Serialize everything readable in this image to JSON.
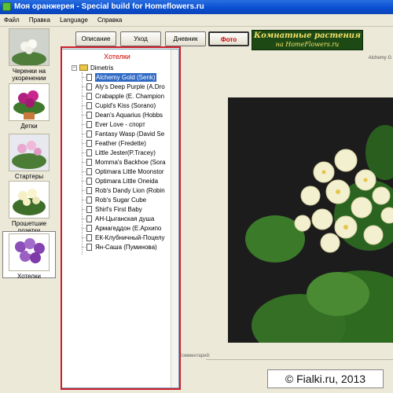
{
  "window": {
    "title": "Моя оранжерея - Special build for Homeflowers.ru"
  },
  "menu": [
    "Файл",
    "Правка",
    "Language",
    "Справка"
  ],
  "sidebar": {
    "items": [
      {
        "label": "Черенки на укоренении",
        "active": false
      },
      {
        "label": "Детки",
        "active": false
      },
      {
        "label": "Стартеры",
        "active": false
      },
      {
        "label": "Прошетшие розетки",
        "active": false
      },
      {
        "label": "Хотелки",
        "active": true
      }
    ]
  },
  "toolbar": {
    "buttons": [
      "Описание",
      "Уход",
      "Дневник",
      "Фото"
    ],
    "active": "Фото"
  },
  "logo": {
    "line1": "Комнатные растения",
    "line2": "на HomeFlowers.ru"
  },
  "panel": {
    "title": "Хотелки",
    "root": "Dimetris",
    "selected": "Alchemy Gold (Senk)",
    "items": [
      "Alchemy Gold (Senk)",
      "Aly's Deep Purple (A.Dro",
      "Crabapple (E. Champion",
      "Cupid's Kiss (Sorano)",
      "Dean's Aquarius (Hobbs",
      "Ever Love - спорт",
      "Fantasy Wasp (David Se",
      "Feather (Fredette)",
      "Little Jester(P.Tracey)",
      "Momma's Backhoe (Sora",
      "Optimara Little Moonstor",
      "Optimara Little Oneida",
      "Rob's Dandy Lion (Robin",
      "Rob's Sugar Cube",
      "Shirl's First Baby",
      "АН-Цыганская душа",
      "Армагеддон (Е.Архипо",
      "ЕК-Клубничный-Поцелу",
      "Ян-Саша (Пуминова)"
    ]
  },
  "photo": {
    "caption": "Alchemy G",
    "comment_label": "Комментарий:"
  },
  "watermark": "© Fialki.ru, 2013",
  "colors": {
    "title_bar": "#0a4fd0",
    "selection": "#316ac5",
    "panel_title": "#d00000",
    "highlight_outline": "#cc1f2f"
  }
}
